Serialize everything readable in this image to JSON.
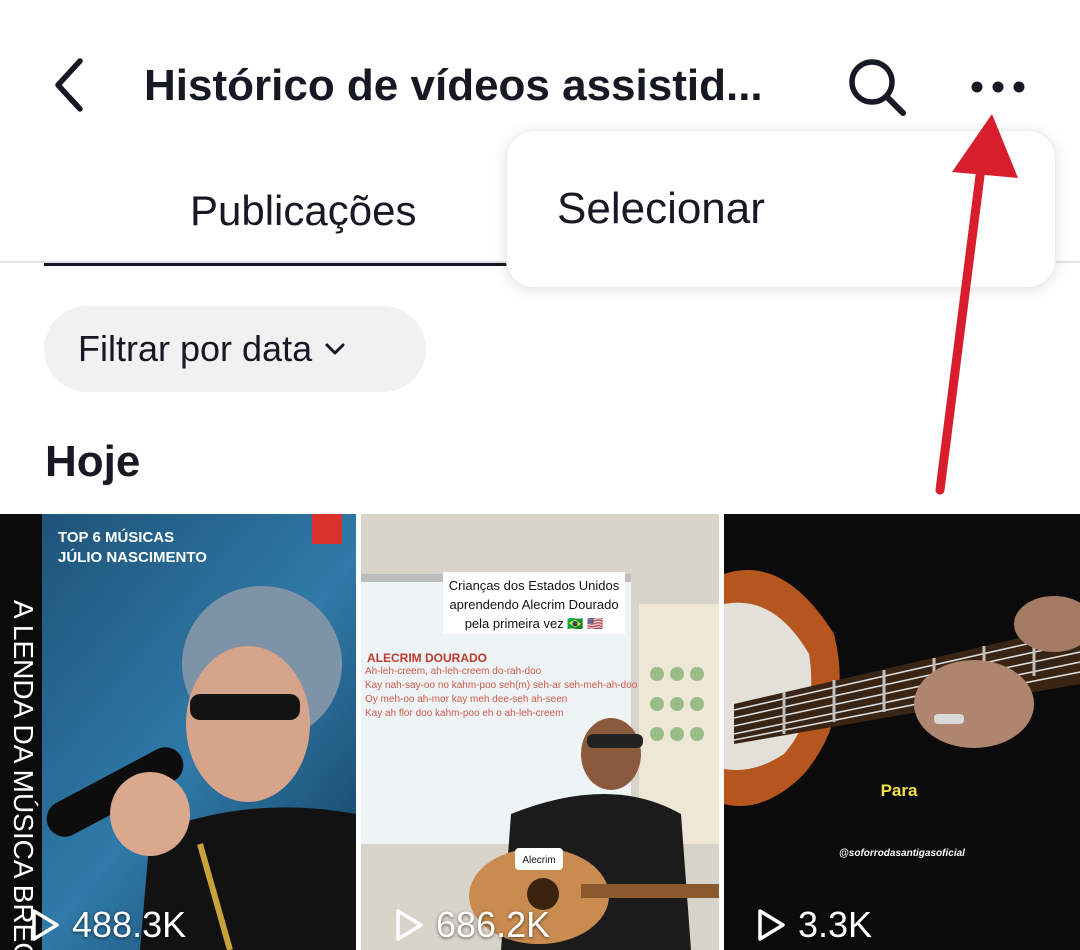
{
  "header": {
    "title": "Histórico de vídeos assistid...",
    "back_icon": "chevron-left-icon",
    "search_icon": "search-icon",
    "more_icon": "more-horizontal-icon"
  },
  "tabs": [
    {
      "label": "Publicações",
      "active": true
    }
  ],
  "filter": {
    "label": "Filtrar por data",
    "icon": "chevron-down-icon"
  },
  "section": {
    "title": "Hoje"
  },
  "videos": [
    {
      "views": "488.3K",
      "overlay_lines": [
        "TOP 6 MÚSICAS",
        "JÚLIO NASCIMENTO"
      ],
      "side_text": "A LENDA DA MÚSICA BREGA"
    },
    {
      "views": "686.2K",
      "caption_lines": [
        "Crianças dos Estados Unidos",
        "aprendendo Alecrim Dourado",
        "pela primeira vez 🇧🇷 🇺🇸"
      ],
      "board_lines": [
        "ALECRIM DOURADO",
        "Ah-leh-creem, ah-leh-creem do-rah-doo",
        "Kay nah-say-oo no kahm-poo seh(m) seh-ar seh-meh-ah-doo",
        "Oy meh-oo ah-mor kay meh dee-seh ah-seen",
        "Kay ah flor doo kahm-poo eh o ah-leh-creem"
      ],
      "tag": "Alecrim"
    },
    {
      "views": "3.3K",
      "caption": "Para",
      "handle": "@soforrodasantigasoficial"
    }
  ],
  "menu": {
    "items": [
      {
        "label": "Selecionar"
      }
    ]
  },
  "annotation": {
    "arrow_color": "#d81e2c"
  }
}
